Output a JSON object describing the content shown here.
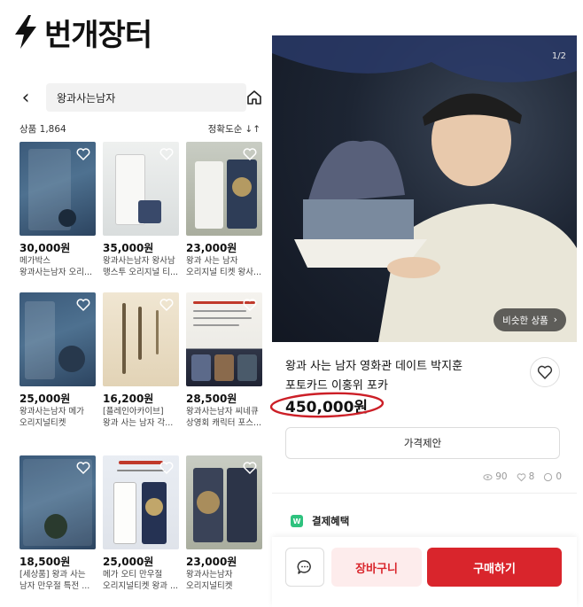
{
  "logo": {
    "icon": "lightning-icon",
    "text": "번개장터"
  },
  "search": {
    "query": "왕과사는남자",
    "back_icon": "chevron-left-icon",
    "home_icon": "home-icon"
  },
  "results": {
    "count_label": "상품 1,864",
    "sort_label": "정확도순",
    "sort_icon": "sort-arrows-icon"
  },
  "listings": [
    {
      "price": "30,000원",
      "line1": "메가박스",
      "line2": "왕과사는남자 오리..."
    },
    {
      "price": "35,000원",
      "line1": "왕과사는남자 왕사남",
      "line2": "맹스투 오리지널 티..."
    },
    {
      "price": "23,000원",
      "line1": "왕과 사는 남자",
      "line2": "오리지널 티켓 왕사..."
    },
    {
      "price": "25,000원",
      "line1": "왕과사는남자 메가",
      "line2": "오리지널티켓"
    },
    {
      "price": "16,200원",
      "line1": "[플레인아카이브]",
      "line2": "왕과 사는 남자 각..."
    },
    {
      "price": "28,500원",
      "line1": "왕과사는남자 씨네큐",
      "line2": "상영회 캐릭터 포스..."
    },
    {
      "price": "18,500원",
      "line1": "[세상품] 왕과 사는",
      "line2": "남자 만우절 특전 ..."
    },
    {
      "price": "25,000원",
      "line1": "메가 오티 만우절",
      "line2": "오리지널티켓 왕과 ..."
    },
    {
      "price": "23,000원",
      "line1": "왕과사는남자",
      "line2": "오리지널티켓"
    }
  ],
  "product": {
    "page_indicator": "1/2",
    "similar_label": "비슷한 상품",
    "title_line1": "왕과 사는 남자 영화관 데이트 박지훈",
    "title_line2": "포토카드 이홍위 포카",
    "price": "450,000원",
    "offer_label": "가격제안",
    "views": "90",
    "likes": "8",
    "chats": "0",
    "benefit_label": "결제혜택",
    "benefit_icon_text": "W"
  },
  "actions": {
    "cart_label": "장바구니",
    "buy_label": "구매하기",
    "chat_icon": "chat-bubble-icon"
  },
  "colors": {
    "brand_red": "#d9252c",
    "cart_bg": "#fdecec",
    "mark_red": "#cc1f27"
  }
}
